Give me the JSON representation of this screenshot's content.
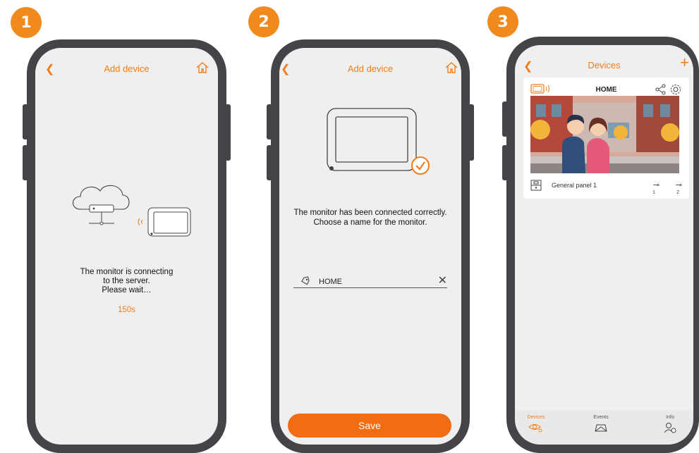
{
  "steps": [
    "1",
    "2",
    "3"
  ],
  "screen1": {
    "title": "Add device",
    "message_line1": "The monitor is connecting",
    "message_line2": "to the server.",
    "message_line3": "Please wait…",
    "countdown": "150s"
  },
  "screen2": {
    "title": "Add device",
    "message_line1": "The monitor has been connected correctly.",
    "message_line2": "Choose a name for the monitor.",
    "name_value": "HOME",
    "save_label": "Save"
  },
  "screen3": {
    "title": "Devices",
    "device_name": "HOME",
    "panel_label": "General panel 1",
    "lock1": "1",
    "lock2": "2",
    "nav": [
      {
        "label": "Devices",
        "icon": "eye-user-icon"
      },
      {
        "label": "Events",
        "icon": "envelope-icon"
      },
      {
        "label": "Info",
        "icon": "user-info-icon"
      }
    ]
  },
  "colors": {
    "accent": "#f07d1a",
    "badge": "#f08a1c",
    "phone_frame": "#444448",
    "screen_bg": "#efefef",
    "save_button": "#f26c12"
  }
}
